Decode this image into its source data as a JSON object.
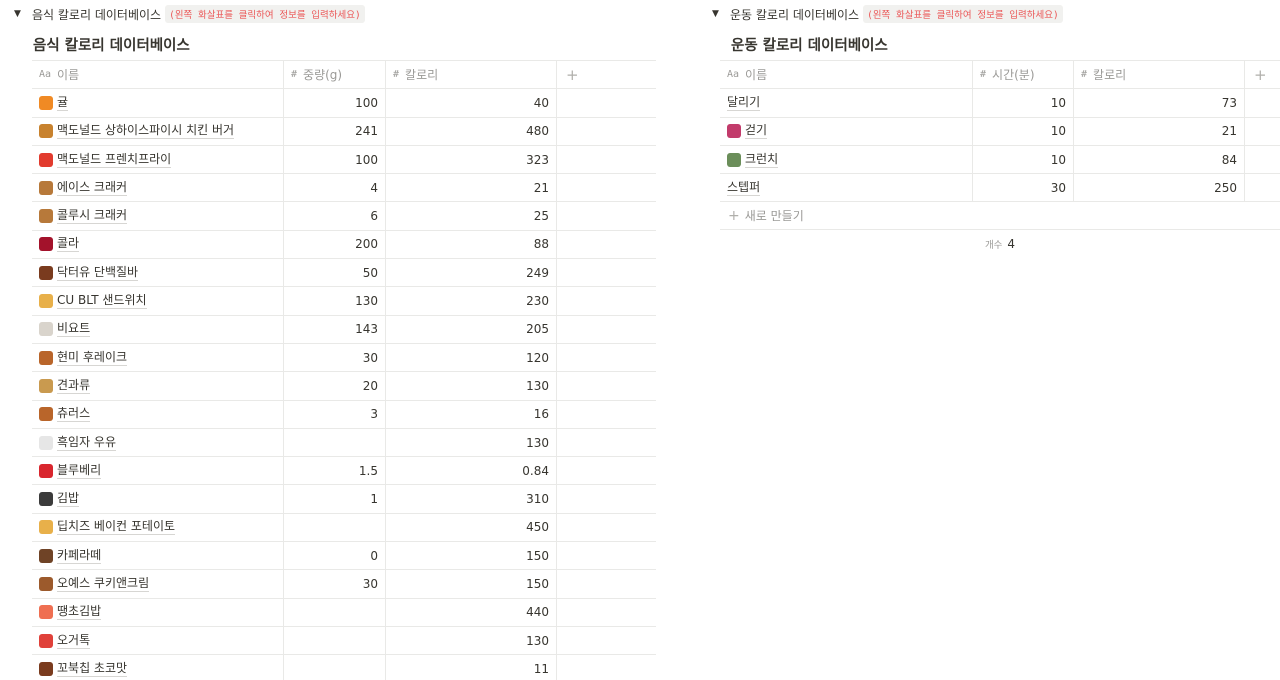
{
  "food_db": {
    "toggle_title": "음식 칼로리 데이터베이스",
    "hint": "(왼쪽 화살표를 클릭하여 정보를 입력하세요)",
    "title": "음식 칼로리 데이터베이스",
    "columns": {
      "name": {
        "icon": "Aa",
        "label": "이름"
      },
      "weight": {
        "icon": "#",
        "label": "중량(g)"
      },
      "calories": {
        "icon": "#",
        "label": "칼로리"
      }
    },
    "rows": [
      {
        "icon": "tangerine-icon",
        "color": "#f08a24",
        "name": "귤",
        "weight": "100",
        "calories": "40"
      },
      {
        "icon": "burger-icon",
        "color": "#c8822e",
        "name": "맥도널드 상하이스파이시 치킨 버거",
        "weight": "241",
        "calories": "480"
      },
      {
        "icon": "fries-icon",
        "color": "#e23b2e",
        "name": "맥도널드 프렌치프라이",
        "weight": "100",
        "calories": "323"
      },
      {
        "icon": "cookie-icon",
        "color": "#b7793a",
        "name": "에이스 크래커",
        "weight": "4",
        "calories": "21"
      },
      {
        "icon": "cookie-icon",
        "color": "#b7793a",
        "name": "콜루시 크래커",
        "weight": "6",
        "calories": "25"
      },
      {
        "icon": "wine-glass-icon",
        "color": "#a3122b",
        "name": "콜라",
        "weight": "200",
        "calories": "88"
      },
      {
        "icon": "chocolate-bar-icon",
        "color": "#7a3b1e",
        "name": "닥터유 단백질바",
        "weight": "50",
        "calories": "249"
      },
      {
        "icon": "sandwich-icon",
        "color": "#e8b04a",
        "name": "CU BLT 샌드위치",
        "weight": "130",
        "calories": "230"
      },
      {
        "icon": "takeout-box-icon",
        "color": "#d9d4cc",
        "name": "비요트",
        "weight": "143",
        "calories": "205"
      },
      {
        "icon": "pretzel-icon",
        "color": "#b9652a",
        "name": "현미 후레이크",
        "weight": "30",
        "calories": "120"
      },
      {
        "icon": "peanuts-icon",
        "color": "#c99a4f",
        "name": "견과류",
        "weight": "20",
        "calories": "130"
      },
      {
        "icon": "pretzel-icon",
        "color": "#b9652a",
        "name": "츄러스",
        "weight": "3",
        "calories": "16"
      },
      {
        "icon": "milk-glass-icon",
        "color": "#e6e6e6",
        "name": "흑임자 우유",
        "weight": "",
        "calories": "130"
      },
      {
        "icon": "strawberry-icon",
        "color": "#d9262e",
        "name": "블루베리",
        "weight": "1.5",
        "calories": "0.84"
      },
      {
        "icon": "rice-ball-icon",
        "color": "#3b3b3b",
        "name": "김밥",
        "weight": "1",
        "calories": "310"
      },
      {
        "icon": "sandwich-icon",
        "color": "#e8b04a",
        "name": "딥치즈 베이컨 포테이토",
        "weight": "",
        "calories": "450"
      },
      {
        "icon": "coffee-icon",
        "color": "#6f4326",
        "name": "카페라떼",
        "weight": "0",
        "calories": "150"
      },
      {
        "icon": "donut-icon",
        "color": "#9c5a2c",
        "name": "오예스 쿠키앤크림",
        "weight": "30",
        "calories": "150"
      },
      {
        "icon": "sushi-icon",
        "color": "#ef6f52",
        "name": "땡초김밥",
        "weight": "",
        "calories": "440"
      },
      {
        "icon": "cup-with-straw-icon",
        "color": "#e0413a",
        "name": "오거톡",
        "weight": "",
        "calories": "130"
      },
      {
        "icon": "chocolate-bar-icon",
        "color": "#7a3b1e",
        "name": "꼬북칩 초코맛",
        "weight": "",
        "calories": "11"
      }
    ]
  },
  "exercise_db": {
    "toggle_title": "운동 칼로리 데이터베이스",
    "hint": "(왼쪽 화살표를 클릭하여 정보를 입력하세요)",
    "title": "운동 칼로리 데이터베이스",
    "columns": {
      "name": {
        "icon": "Aa",
        "label": "이름"
      },
      "time": {
        "icon": "#",
        "label": "시간(분)"
      },
      "calories": {
        "icon": "#",
        "label": "칼로리"
      }
    },
    "rows": [
      {
        "icon": "",
        "color": "",
        "name": "달리기",
        "time": "10",
        "calories": "73"
      },
      {
        "icon": "person-walking-icon",
        "color": "#c23b6b",
        "name": "걷기",
        "time": "10",
        "calories": "21"
      },
      {
        "icon": "person-lying-icon",
        "color": "#6b8e5a",
        "name": "크런치",
        "time": "10",
        "calories": "84"
      },
      {
        "icon": "",
        "color": "",
        "name": "스텝퍼",
        "time": "30",
        "calories": "250"
      }
    ],
    "new_label": "새로 만들기",
    "count_label": "개수",
    "count_value": "4"
  }
}
